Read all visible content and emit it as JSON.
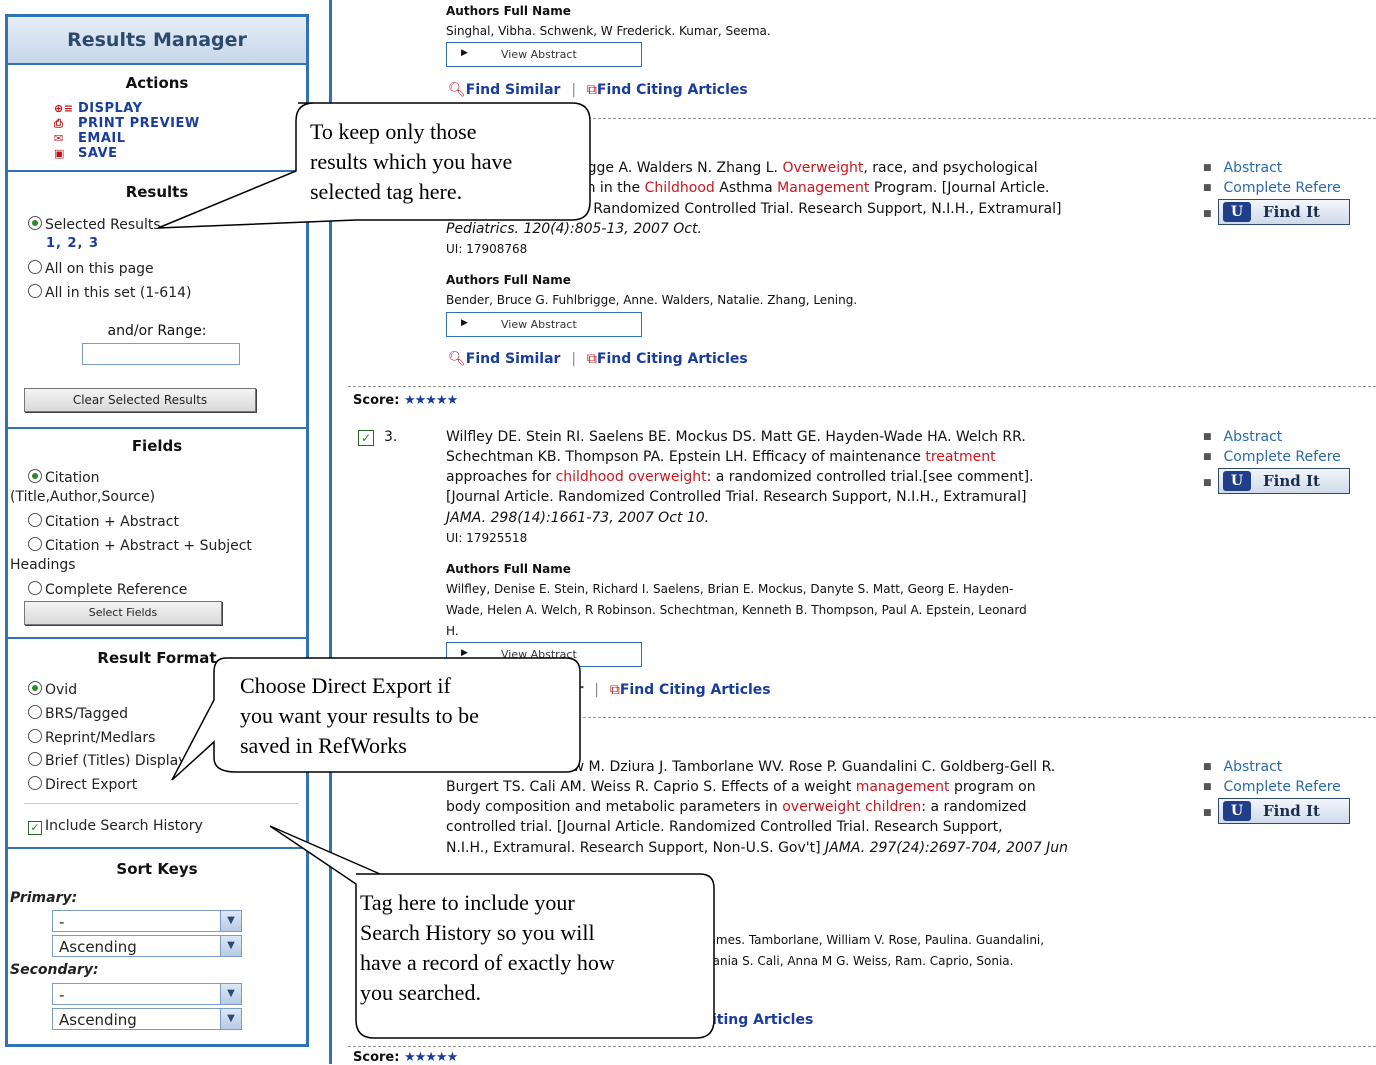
{
  "sidebar": {
    "title": "Results Manager",
    "actions": {
      "heading": "Actions",
      "items": [
        {
          "label": "DISPLAY",
          "icon": "display-icon"
        },
        {
          "label": "PRINT PREVIEW",
          "icon": "print-preview-icon"
        },
        {
          "label": "EMAIL",
          "icon": "email-icon"
        },
        {
          "label": "SAVE",
          "icon": "save-icon"
        }
      ]
    },
    "results": {
      "heading": "Results",
      "selected": "Selected Results",
      "selected_ids": "1, 2, 3",
      "all_page": "All on this page",
      "all_set": "All in this set (1-614)",
      "range_label": "and/or Range:",
      "range_value": "",
      "clear_button": "Clear Selected Results"
    },
    "fields": {
      "heading": "Fields",
      "citation": "Citation",
      "citation_sub": "(Title,Author,Source)",
      "citation_abstract": "Citation + Abstract",
      "citation_abstract_subject": "Citation + Abstract + Subject",
      "citation_abstract_subject_2": "Headings",
      "complete_reference": "Complete Reference",
      "select_button": "Select Fields"
    },
    "format": {
      "heading": "Result Format",
      "ovid": "Ovid",
      "brs": "BRS/Tagged",
      "reprint": "Reprint/Medlars",
      "brief": "Brief (Titles) Display",
      "direct_export": "Direct Export",
      "include_history": "Include Search History",
      "include_history_checked": true
    },
    "sort": {
      "heading": "Sort Keys",
      "primary_label": "Primary:",
      "primary_value": "-",
      "primary_order": "Ascending",
      "secondary_label": "Secondary:",
      "secondary_value": "-",
      "secondary_order": "Ascending"
    }
  },
  "results": {
    "r1": {
      "authors_heading": "Authors Full Name",
      "authors": "Singhal, Vibha. Schwenk, W Frederick. Kumar, Seema.",
      "view_abstract": "View Abstract",
      "find_similar": "Find Similar",
      "sep": "|",
      "find_citing": "Find Citing Articles"
    },
    "r2": {
      "line1_a": "rigge A. Walders N. Zhang L. ",
      "line1_b": "Overweight",
      "line1_c": ", race, and psychological",
      "line2_a": "en in the ",
      "line2_b": "Childhood",
      "line2_c": " Asthma ",
      "line2_d": "Management",
      "line2_e": " Program. [Journal Article.",
      "line3": "y. Randomized Controlled Trial. Research Support, N.I.H., Extramural]",
      "line4": "Pediatrics. 120(4):805-13, 2007 Oct.",
      "ui": "UI: 17908768",
      "authors_heading": "Authors Full Name",
      "authors": "Bender, Bruce G. Fuhlbrigge, Anne. Walders, Natalie. Zhang, Lening.",
      "view_abstract": "View Abstract",
      "find_similar": "Find Similar",
      "sep": "|",
      "find_citing": "Find Citing Articles",
      "link_abstract": "Abstract",
      "link_complete": "Complete Refere",
      "find_it": "Find It"
    },
    "r3": {
      "score_label": "Score:",
      "stars": "★★★★★",
      "number": "3.",
      "line1": "Wilfley DE. Stein RI. Saelens BE. Mockus DS. Matt GE. Hayden-Wade HA. Welch RR.",
      "line2_a": "Schechtman KB. Thompson PA. Epstein LH. Efficacy of maintenance ",
      "line2_b": "treatment",
      "line3_a": "approaches for ",
      "line3_b": "childhood overweight",
      "line3_c": ": a randomized controlled trial.[see comment].",
      "line4": "[Journal Article. Randomized Controlled Trial. Research Support, N.I.H., Extramural]",
      "line5": "JAMA. 298(14):1661-73, 2007 Oct 10.",
      "ui": "UI: 17925518",
      "authors_heading": "Authors Full Name",
      "authors_1": "Wilfley, Denise E. Stein, Richard I. Saelens, Brian E. Mockus, Danyte S. Matt, Georg E. Hayden-",
      "authors_2": "Wade, Helen A. Welch, R Robinson. Schechtman, Kenneth B. Thompson, Paul A. Epstein, Leonard",
      "authors_3": "H.",
      "view_abstract": "View Abstract",
      "find_similar_tail": "ar",
      "sep": "|",
      "find_citing": "Find Citing Articles",
      "link_abstract": "Abstract",
      "link_complete": "Complete Refere",
      "find_it": "Find It"
    },
    "r4": {
      "line1": "aw M. Dziura J. Tamborlane WV. Rose P. Guandalini C. Goldberg-Gell R.",
      "line2_a": "Burgert TS. Cali AM. Weiss R. Caprio S. Effects of a weight ",
      "line2_b": "management",
      "line2_c": " program on",
      "line3_a": "body composition and metabolic parameters in ",
      "line3_b": "overweight children",
      "line3_c": ": a randomized",
      "line4": "controlled trial. [Journal Article. Randomized Controlled Trial. Research Support,",
      "line5_a": "N.I.H., Extramural. Research Support, Non-U.S. Gov't] ",
      "line5_b": "JAMA. 297(24):2697-704, 2007 Jun",
      "authors_1": "a, James. Tamborlane, William V. Rose, Paulina. Guandalini,",
      "authors_2": "rt, Tania S. Cali, Anna M G. Weiss, Ram. Caprio, Sonia.",
      "find_citing_tail": "iting Articles",
      "link_abstract": "Abstract",
      "link_complete": "Complete Refere",
      "find_it": "Find It"
    },
    "r5": {
      "score_label": "Score:",
      "stars": "★★★★★"
    }
  },
  "callouts": {
    "c1_l1": "To keep only those",
    "c1_l2": "results which you have",
    "c1_l3": "selected tag here.",
    "c2_l1": "Choose Direct Export if",
    "c2_l2": "you want your results to be",
    "c2_l3": "saved in RefWorks",
    "c3_l1": "Tag here to include your",
    "c3_l2": "Search History so you will",
    "c3_l3": "have a record of exactly how",
    "c3_l4": "you searched."
  }
}
